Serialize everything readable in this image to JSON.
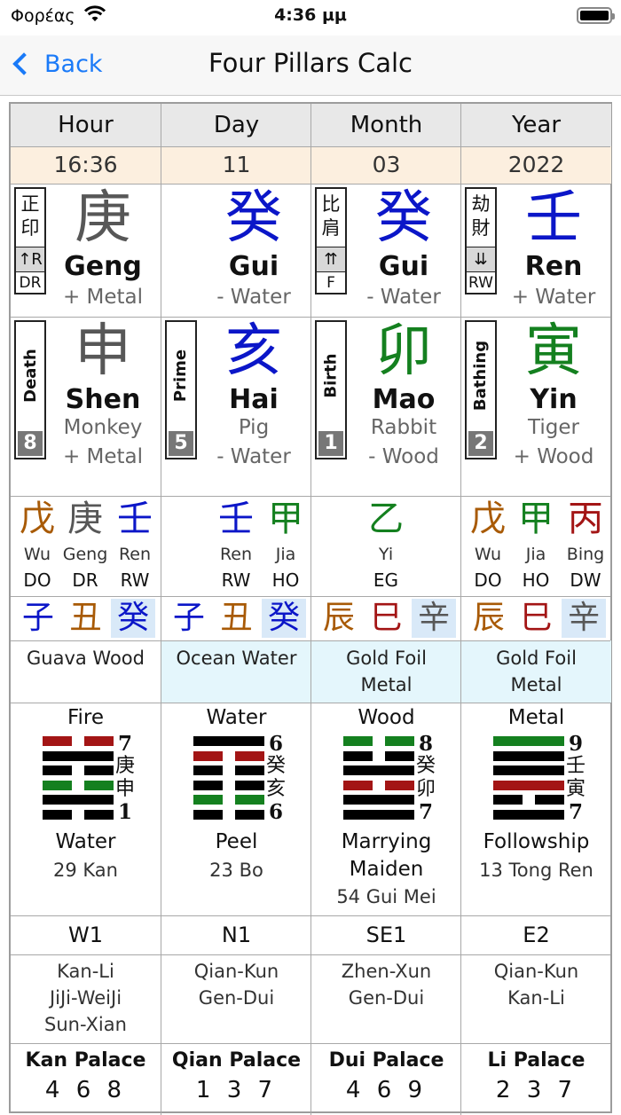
{
  "status": {
    "carrier": "Φορέας",
    "time": "4:36 μμ"
  },
  "nav": {
    "back_label": "Back",
    "title": "Four Pillars Calc"
  },
  "colors": {
    "red": "#a31515",
    "blue": "#0b16c8",
    "green": "#14801f",
    "brown": "#a85a06",
    "gray": "#575757"
  },
  "pillars": [
    {
      "header": "Hour",
      "date": "16:36",
      "stem": {
        "god": "正\n印",
        "arrow": "↑R",
        "god_abbr": "DR",
        "char": "庚",
        "color": "gray",
        "pinyin": "Geng",
        "element": "+ Metal"
      },
      "branch": {
        "stage": "Death",
        "num": "8",
        "char": "申",
        "color": "gray",
        "pinyin": "Shen",
        "animal": "Monkey",
        "element": "+ Metal"
      },
      "hidden": [
        {
          "char": "戊",
          "color": "brown",
          "name": "Wu",
          "god": "DO"
        },
        {
          "char": "庚",
          "color": "gray",
          "name": "Geng",
          "god": "DR"
        },
        {
          "char": "壬",
          "color": "blue",
          "name": "Ren",
          "god": "RW"
        }
      ],
      "mix": [
        {
          "char": "子",
          "color": "blue"
        },
        {
          "char": "丑",
          "color": "brown"
        },
        {
          "char": "癸",
          "color": "blue",
          "hl": true
        }
      ],
      "nayin": "Guava Wood",
      "nayin_bg": "#ffffff",
      "hex": {
        "top": "Fire",
        "num_top": "7",
        "chars": "庚申",
        "num_bot": "1",
        "bot": "Water",
        "name": "29 Kan",
        "lines": [
          "red-broken",
          "black-solid",
          "black-broken",
          "green-broken",
          "black-solid",
          "black-broken"
        ]
      },
      "dir": "W1",
      "pairs": "Kan-Li\nJiJi-WeiJi\nSun-Xian",
      "palace": "Kan Palace",
      "palace_nums": "4 6 8"
    },
    {
      "header": "Day",
      "date": "11",
      "stem": {
        "god": "",
        "arrow": "",
        "god_abbr": "",
        "char": "癸",
        "color": "blue",
        "pinyin": "Gui",
        "element": "- Water"
      },
      "branch": {
        "stage": "Prime",
        "num": "5",
        "char": "亥",
        "color": "blue",
        "pinyin": "Hai",
        "animal": "Pig",
        "element": "- Water"
      },
      "hidden": [
        {
          "char": "壬",
          "color": "blue",
          "name": "Ren",
          "god": "RW"
        },
        {
          "char": "甲",
          "color": "green",
          "name": "Jia",
          "god": "HO"
        }
      ],
      "mix": [
        {
          "char": "子",
          "color": "blue"
        },
        {
          "char": "丑",
          "color": "brown"
        },
        {
          "char": "癸",
          "color": "blue",
          "hl": true
        }
      ],
      "nayin": "Ocean Water",
      "nayin_bg": "#e4f6fc",
      "hex": {
        "top": "Water",
        "num_top": "6",
        "chars": "癸亥",
        "num_bot": "6",
        "bot": "Peel",
        "name": "23 Bo",
        "lines": [
          "black-solid",
          "red-broken",
          "black-broken",
          "black-broken",
          "green-broken",
          "black-broken"
        ]
      },
      "dir": "N1",
      "pairs": "Qian-Kun\nGen-Dui",
      "palace": "Qian Palace",
      "palace_nums": "1 3 7"
    },
    {
      "header": "Month",
      "date": "03",
      "stem": {
        "god": "比\n肩",
        "arrow": "⇈",
        "god_abbr": "F",
        "char": "癸",
        "color": "blue",
        "pinyin": "Gui",
        "element": "- Water"
      },
      "branch": {
        "stage": "Birth",
        "num": "1",
        "char": "卯",
        "color": "green",
        "pinyin": "Mao",
        "animal": "Rabbit",
        "element": "- Wood"
      },
      "hidden": [
        {
          "char": "乙",
          "color": "green",
          "name": "Yi",
          "god": "EG"
        }
      ],
      "mix": [
        {
          "char": "辰",
          "color": "brown"
        },
        {
          "char": "巳",
          "color": "red"
        },
        {
          "char": "辛",
          "color": "gray",
          "hl": true
        }
      ],
      "nayin": "Gold Foil\nMetal",
      "nayin_bg": "#e4f6fc",
      "hex": {
        "top": "Wood",
        "num_top": "8",
        "chars": "癸卯",
        "num_bot": "7",
        "bot": "Marrying\nMaiden",
        "name": "54 Gui Mei",
        "lines": [
          "green-broken",
          "black-broken",
          "black-solid",
          "red-broken",
          "black-solid",
          "black-solid"
        ]
      },
      "dir": "SE1",
      "pairs": "Zhen-Xun\nGen-Dui",
      "palace": "Dui Palace",
      "palace_nums": "4 6 9"
    },
    {
      "header": "Year",
      "date": "2022",
      "stem": {
        "god": "劫\n財",
        "arrow": "⇊",
        "god_abbr": "RW",
        "char": "壬",
        "color": "blue",
        "pinyin": "Ren",
        "element": "+ Water"
      },
      "branch": {
        "stage": "Bathing",
        "num": "2",
        "char": "寅",
        "color": "green",
        "pinyin": "Yin",
        "animal": "Tiger",
        "element": "+ Wood"
      },
      "hidden": [
        {
          "char": "戊",
          "color": "brown",
          "name": "Wu",
          "god": "DO"
        },
        {
          "char": "甲",
          "color": "green",
          "name": "Jia",
          "god": "HO"
        },
        {
          "char": "丙",
          "color": "red",
          "name": "Bing",
          "god": "DW"
        }
      ],
      "mix": [
        {
          "char": "辰",
          "color": "brown"
        },
        {
          "char": "巳",
          "color": "red"
        },
        {
          "char": "辛",
          "color": "gray",
          "hl": true
        }
      ],
      "nayin": "Gold Foil\nMetal",
      "nayin_bg": "#e4f6fc",
      "hex": {
        "top": "Metal",
        "num_top": "9",
        "chars": "壬寅",
        "num_bot": "7",
        "bot": "Followship",
        "name": "13 Tong Ren",
        "lines": [
          "green-solid",
          "black-solid",
          "black-solid",
          "red-solid",
          "black-broken",
          "black-solid"
        ]
      },
      "dir": "E2",
      "pairs": "Qian-Kun\nKan-Li",
      "palace": "Li Palace",
      "palace_nums": "2 3 7"
    }
  ]
}
